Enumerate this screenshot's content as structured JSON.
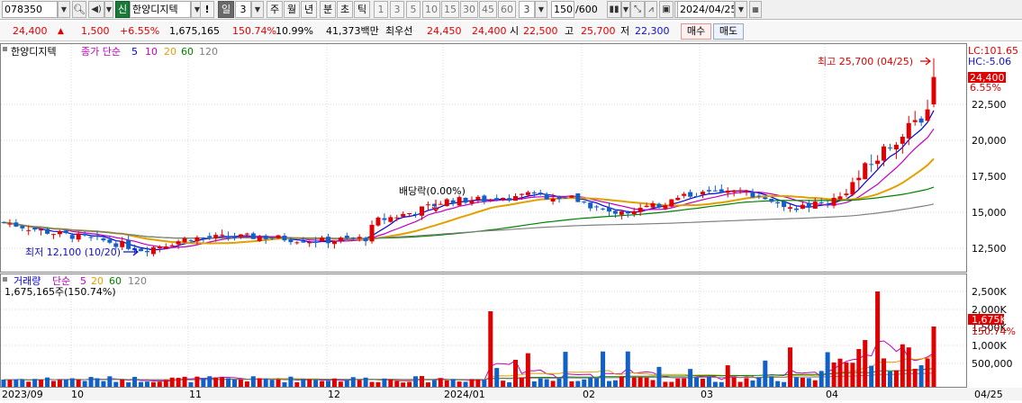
{
  "toolbar": {
    "code": "078350",
    "market_badge": "신",
    "name": "한양디지텍",
    "period_day": "일",
    "period_value": "3",
    "periods": [
      "주",
      "월",
      "년",
      "분",
      "초",
      "틱"
    ],
    "minute_numbers": [
      "1",
      "3",
      "5",
      "10",
      "15",
      "30",
      "45",
      "60"
    ],
    "extra_value": "3",
    "range": "150",
    "range_total": "/600",
    "date": "2024/04/25",
    "exclamation": "!"
  },
  "quote": {
    "price": "24,400",
    "change": "1,500",
    "change_pct": "+6.55%",
    "volume": "1,675,165",
    "volume_ratio": "150.74%",
    "turnover": "10.99%",
    "amount": "41,373백만",
    "best_label": "최우선",
    "best_ask": "24,450",
    "best_bid": "24,400",
    "open_label": "시",
    "open": "22,500",
    "high_label": "고",
    "high": "25,700",
    "low_label": "저",
    "low": "22,300",
    "buy_label": "매수",
    "sell_label": "매도"
  },
  "price_panel": {
    "legend_name": "한양디지텍",
    "legend_series": "종가 단순",
    "ma_periods": [
      {
        "label": "5",
        "color": "#0000e0"
      },
      {
        "label": "10",
        "color": "#c000c0"
      },
      {
        "label": "20",
        "color": "#e0a000"
      },
      {
        "label": "60",
        "color": "#008000"
      },
      {
        "label": "120",
        "color": "#808080"
      }
    ],
    "lc_label": "LC:101.65",
    "hc_label": "HC:-5.06",
    "last_price_tag": "24,400",
    "last_pct_tag": "6.55%",
    "y_ticks": [
      "22,500",
      "20,000",
      "17,500",
      "15,000",
      "12,500"
    ],
    "high_annotation": "최고 25,700 (04/25)",
    "low_annotation": "최저 12,100 (10/20)",
    "dividend_annotation": "배당락(0.00%)"
  },
  "volume_panel": {
    "legend_name": "거래량",
    "legend_series": "단순",
    "ma_periods": [
      {
        "label": "5",
        "color": "#c000c0"
      },
      {
        "label": "20",
        "color": "#e0a000"
      },
      {
        "label": "60",
        "color": "#008000"
      },
      {
        "label": "120",
        "color": "#808080"
      }
    ],
    "summary": "1,675,165주(150.74%)",
    "y_ticks": [
      "2,500K",
      "2,000K",
      "1,500K",
      "1,000K",
      "500,000"
    ],
    "last_volume_tag": "1,675K",
    "last_pct_tag": "150.74%"
  },
  "x_axis": {
    "labels": [
      "2023/09",
      "10",
      "11",
      "12",
      "2024/01",
      "02",
      "03",
      "04",
      "04/25"
    ]
  },
  "colors": {
    "up": "#e00000",
    "down": "#1060c8",
    "panel_border": "#808080",
    "grid": "#d8d8d8"
  }
}
